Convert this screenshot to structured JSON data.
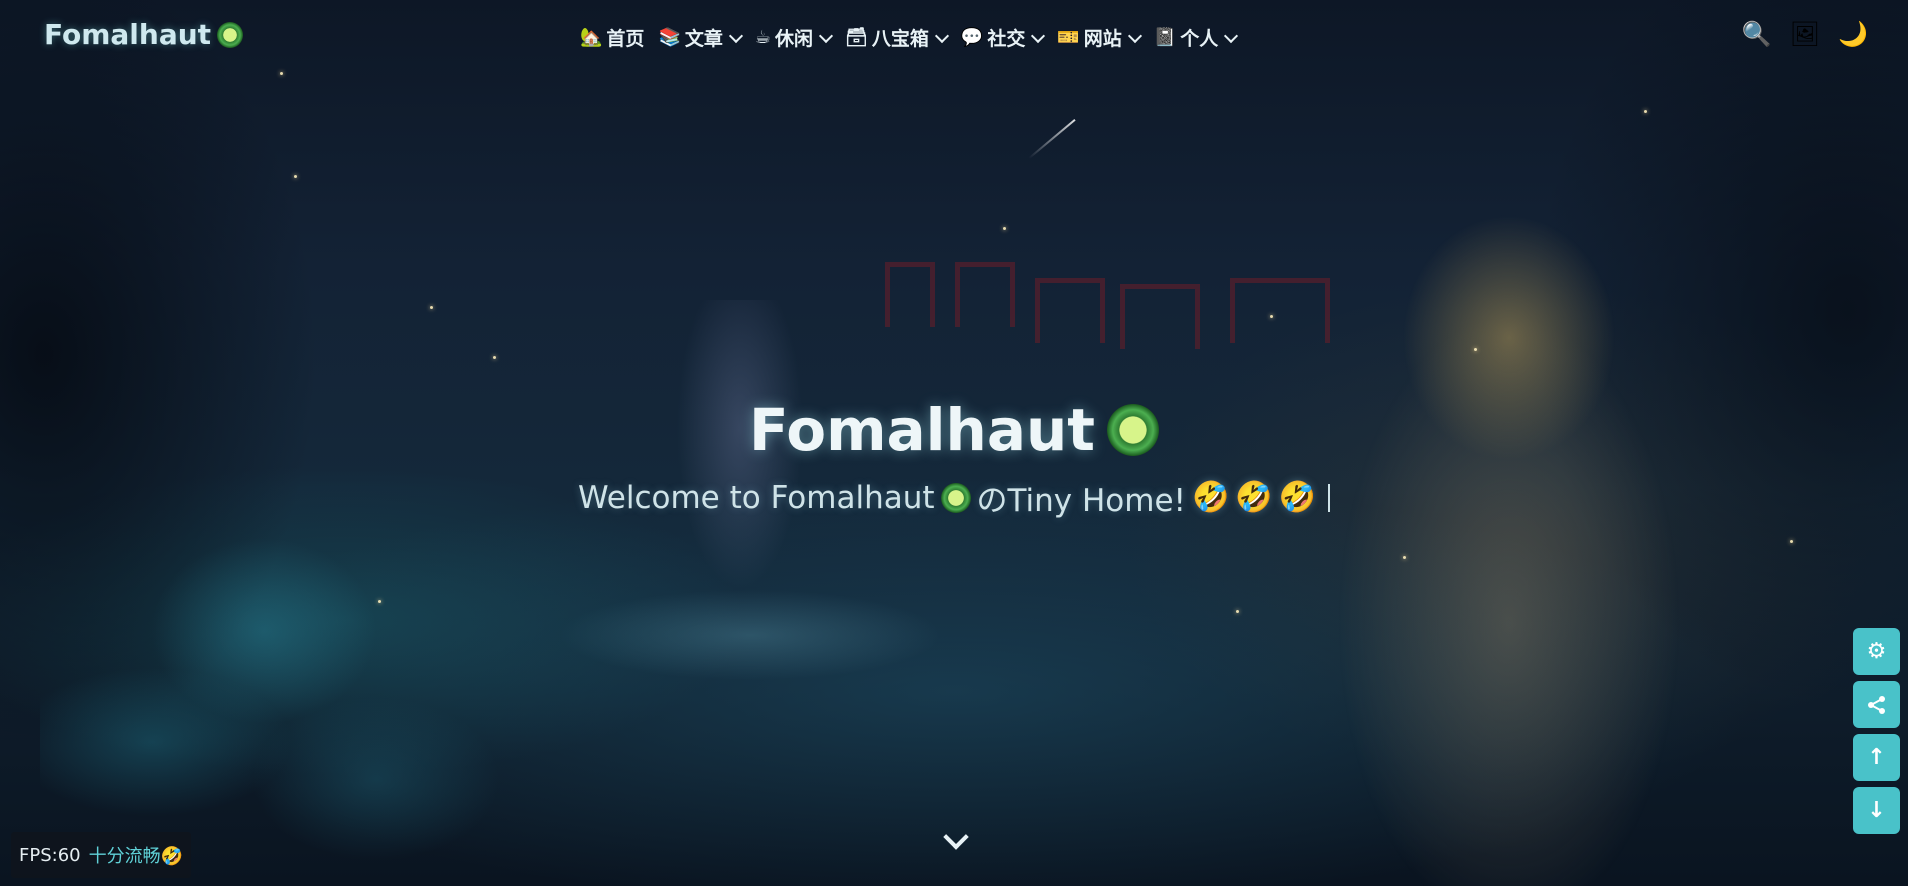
{
  "brand": {
    "name": "Fomalhaut",
    "logo_icon": "kiwi-fruit-icon"
  },
  "nav": {
    "items": [
      {
        "label": "首页",
        "icon": "🏡",
        "has_dropdown": false
      },
      {
        "label": "文章",
        "icon": "📚",
        "has_dropdown": true
      },
      {
        "label": "休闲",
        "icon": "☕",
        "has_dropdown": true
      },
      {
        "label": "八宝箱",
        "icon": "🗃",
        "has_dropdown": true
      },
      {
        "label": "社交",
        "icon": "💬",
        "has_dropdown": true
      },
      {
        "label": "网站",
        "icon": "🎫",
        "has_dropdown": true
      },
      {
        "label": "个人",
        "icon": "📓",
        "has_dropdown": true
      }
    ]
  },
  "tools": {
    "search_icon": "🔍",
    "wallpaper_icon": "🖼",
    "darkmode_icon": "🌙"
  },
  "hero": {
    "title": "Fomalhaut",
    "subtitle_prefix": "Welcome to Fomalhaut",
    "subtitle_suffix": "のTiny Home!",
    "emojis": [
      "🤣",
      "🤣",
      "🤣"
    ]
  },
  "side_buttons": {
    "settings_icon": "⚙",
    "share_icon": "share",
    "up_icon": "↑",
    "down_icon": "↓"
  },
  "fps": {
    "label": "FPS:60",
    "status": "十分流畅",
    "emoji": "🤣"
  },
  "colors": {
    "accent": "#49c2c9",
    "nav_text": "#e8f2f6",
    "fps_status": "#5fd0d6"
  }
}
